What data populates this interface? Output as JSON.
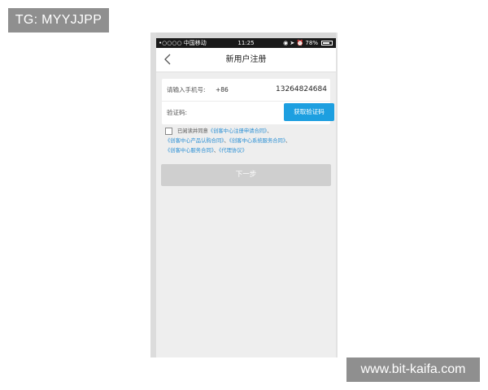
{
  "watermark": {
    "top_left": "TG: MYYJJPP",
    "bottom_right": "www.bit-kaifa.com"
  },
  "status_bar": {
    "carrier": "•○○○○ 中国移动",
    "time": "11:25",
    "indicators": "◉ ➤ ⏰ 78%",
    "battery_level": 0.78
  },
  "nav": {
    "back_icon": "chevron-left-icon",
    "title": "新用户注册"
  },
  "form": {
    "phone_label": "请输入手机号:",
    "country_code": "+86",
    "phone_number": "13264824684",
    "code_label": "验证码:",
    "code_value": "",
    "get_code_button": "获取验证码"
  },
  "agreement": {
    "prefix": "已阅读并同意",
    "link1": "《创客中心注册申请合同》",
    "sep1": "、",
    "link2": "《创客中心产品认购合同》",
    "sep2": "、",
    "link3": "《创客中心系统服务合同》",
    "sep3": "、",
    "link4": "《创客中心服务合同》",
    "sep4": "、",
    "link5": "《代理协议》",
    "checked": false
  },
  "next_button": "下一步",
  "colors": {
    "accent": "#1d9fe0",
    "link": "#2a8fd4",
    "disabled_button": "#cfcfcf",
    "background": "#eeeeee"
  }
}
